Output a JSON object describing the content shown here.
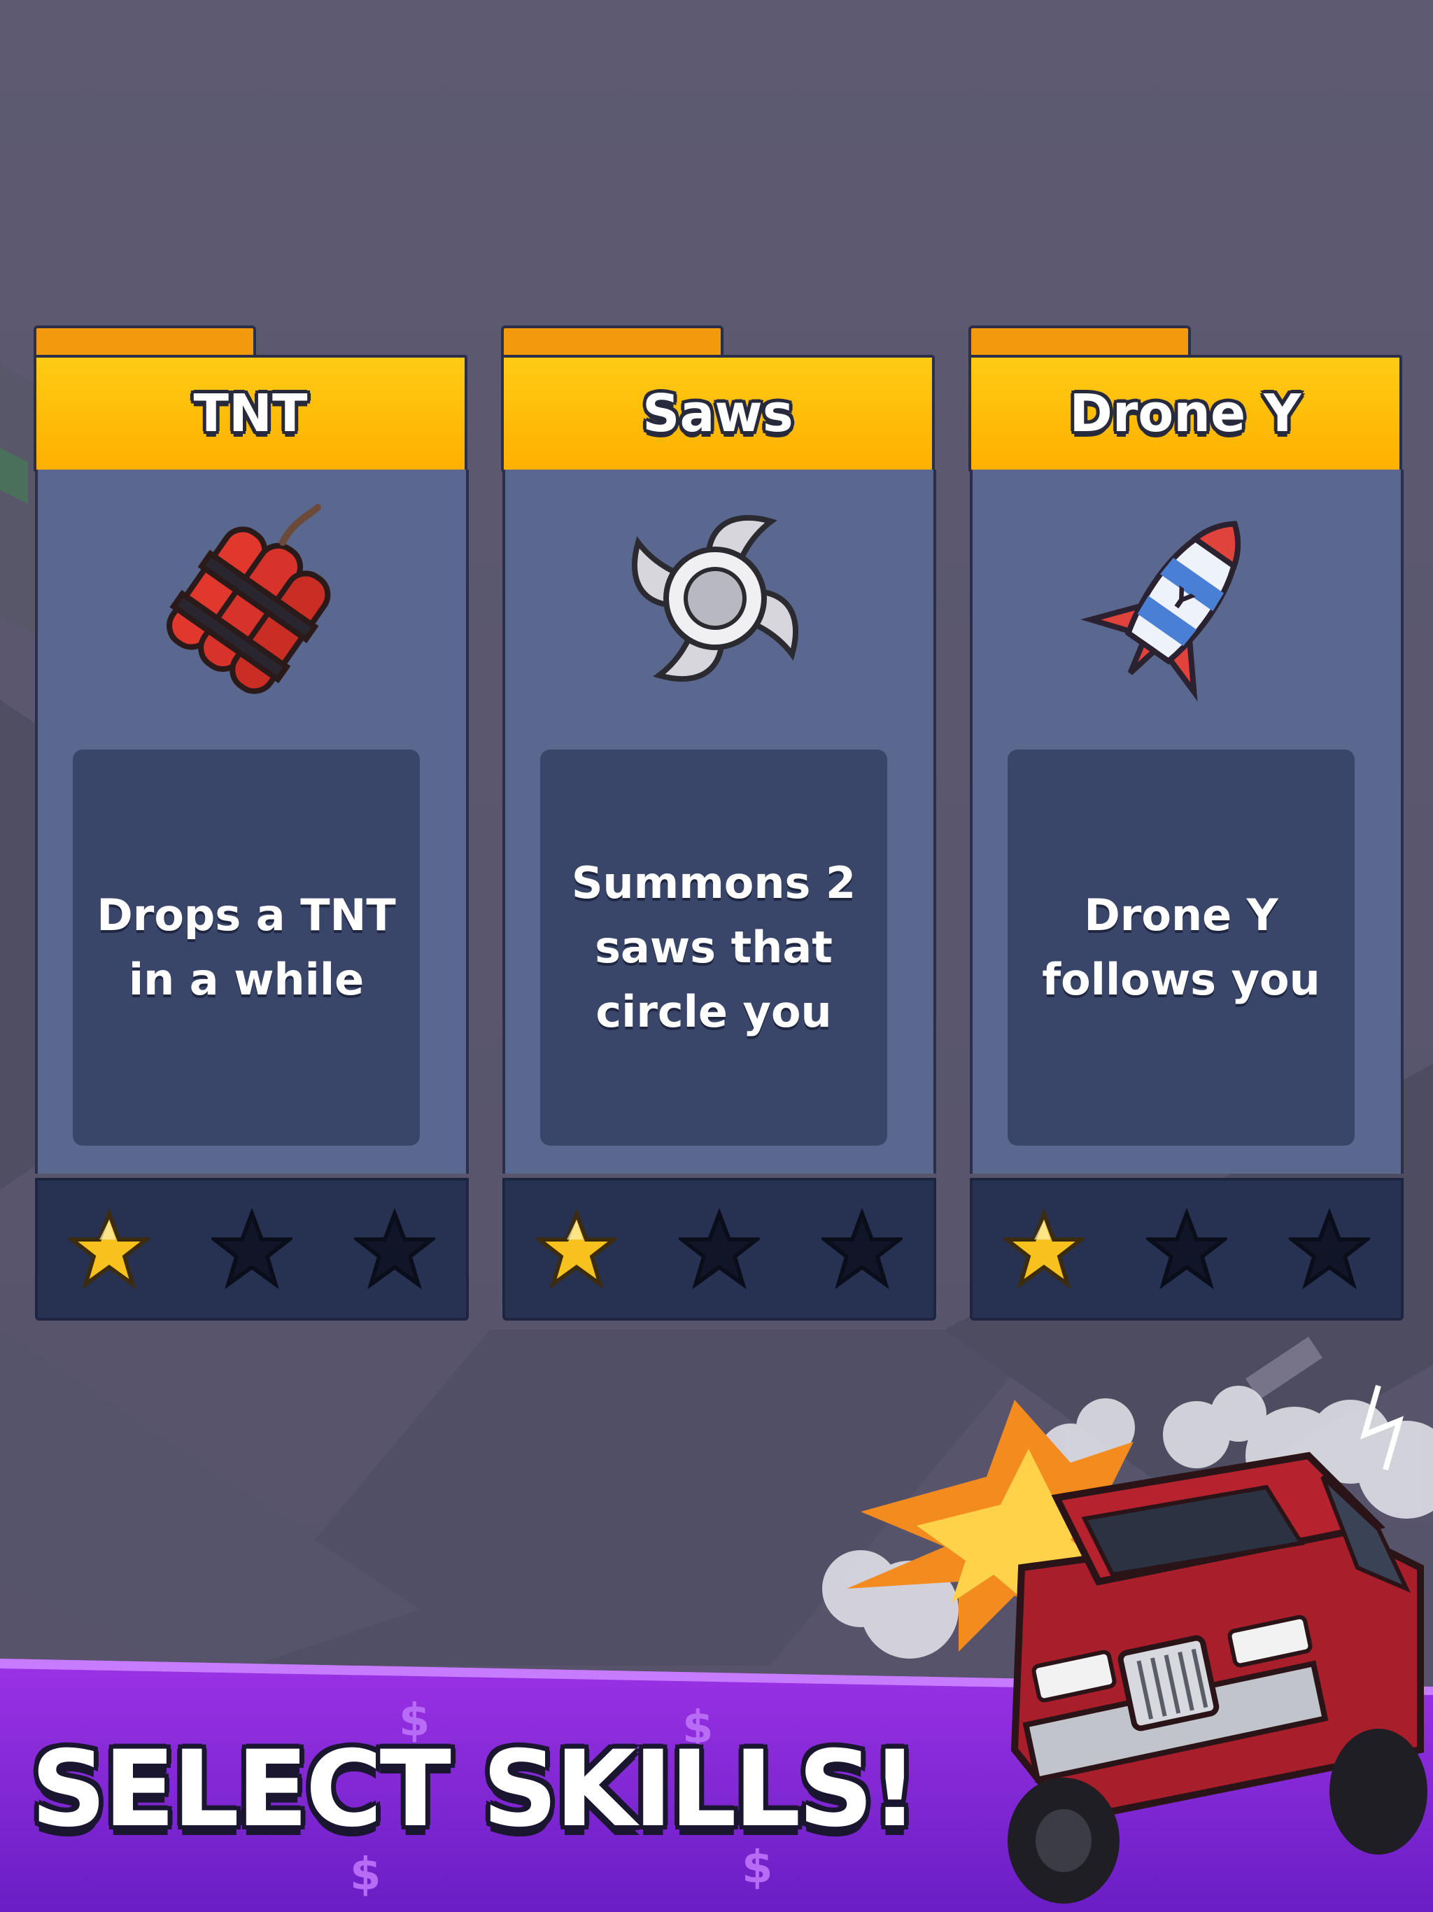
{
  "screen_title": "SELECT SKILLS!",
  "colors": {
    "background": "#5e5a72",
    "header": "#ffbe0b",
    "card_body": "#5a6890",
    "desc_panel": "#3a4669",
    "star_bar": "#273252",
    "star_filled": "#f7c21d",
    "star_empty": "#101628",
    "banner": "#8a2be2"
  },
  "skills": [
    {
      "name": "TNT",
      "icon": "dynamite-icon",
      "description": "Drops a TNT in a while",
      "stars_filled": 1,
      "stars_total": 3
    },
    {
      "name": "Saws",
      "icon": "saw-blade-icon",
      "description": "Summons 2 saws that circle you",
      "stars_filled": 1,
      "stars_total": 3
    },
    {
      "name": "Drone Y",
      "icon": "rocket-drone-icon",
      "description": "Drone Y follows you",
      "stars_filled": 1,
      "stars_total": 3
    }
  ]
}
